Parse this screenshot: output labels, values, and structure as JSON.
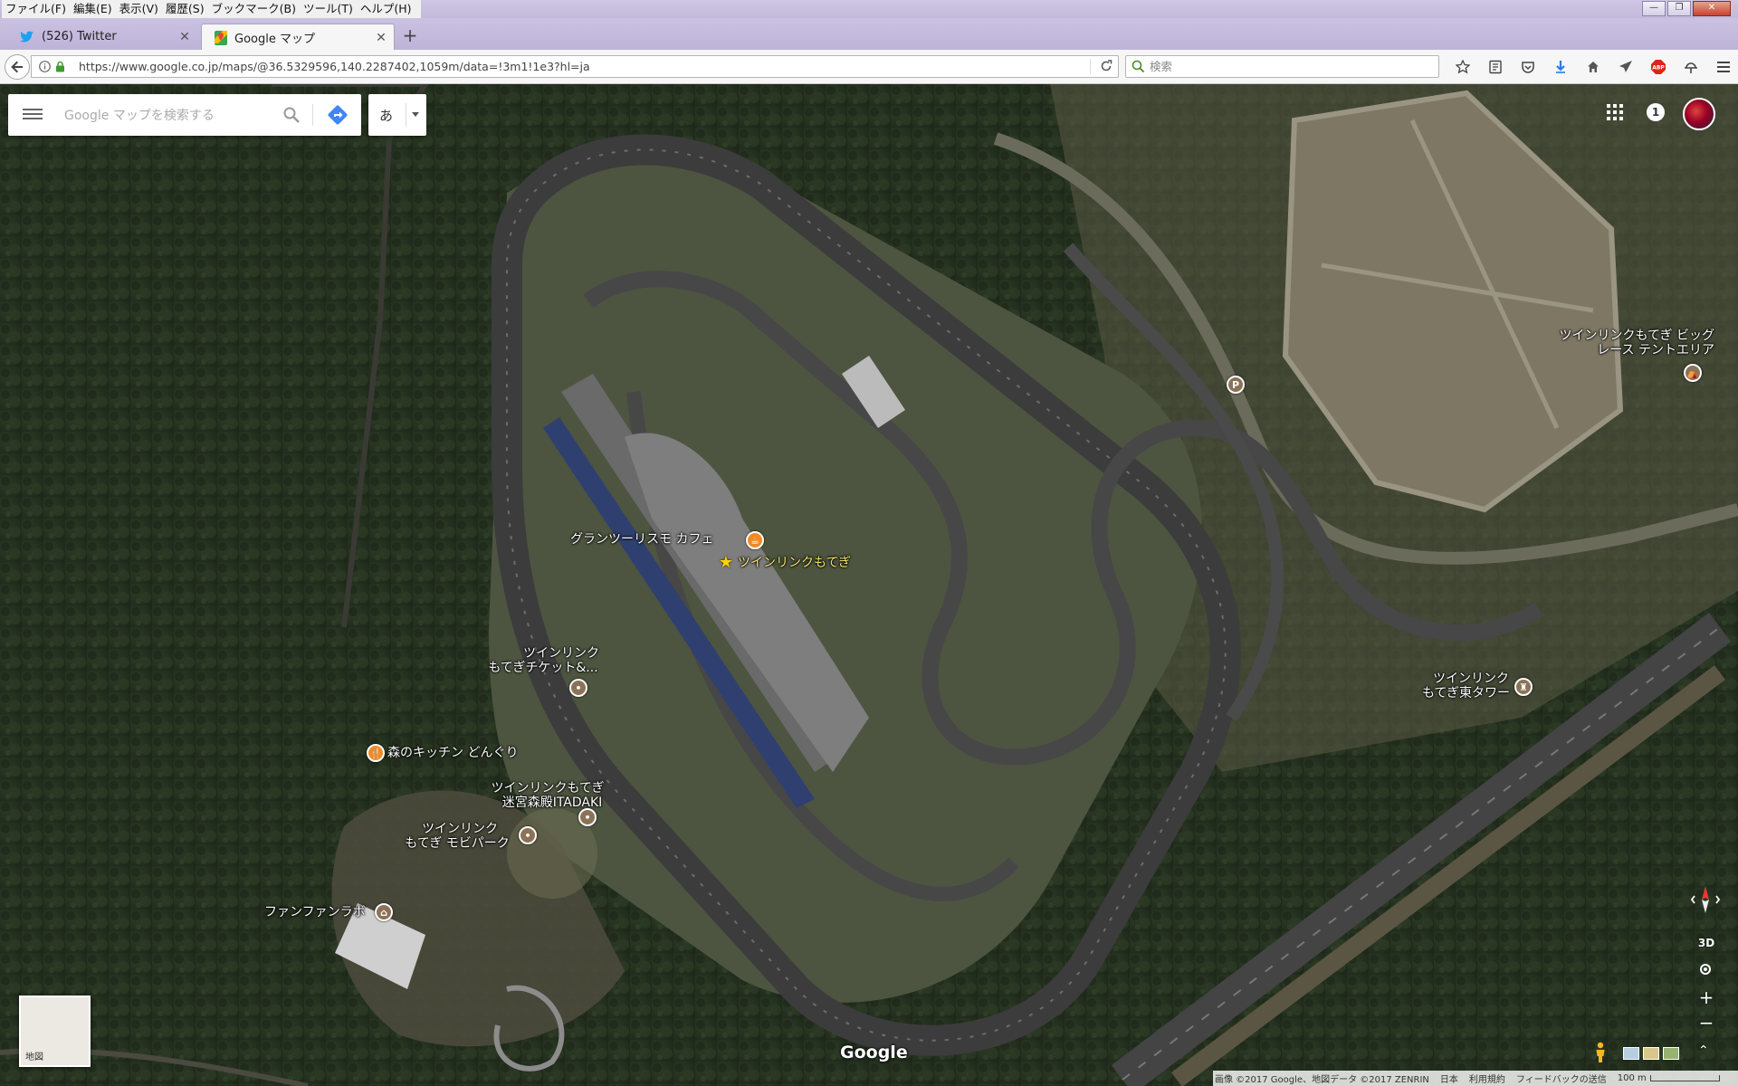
{
  "browser": {
    "menus": [
      "ファイル(F)",
      "編集(E)",
      "表示(V)",
      "履歴(S)",
      "ブックマーク(B)",
      "ツール(T)",
      "ヘルプ(H)"
    ],
    "tabs": [
      {
        "title": "(526) Twitter",
        "active": false,
        "icon": "twitter-bird-icon"
      },
      {
        "title": "Google マップ",
        "active": true,
        "icon": "google-maps-icon"
      }
    ],
    "url": "https://www.google.co.jp/maps/@36.5329596,140.2287402,1059m/data=!3m1!1e3?hl=ja",
    "search_placeholder": "検索",
    "toolbar_icons": [
      "bookmark-star-icon",
      "reading-list-icon",
      "pocket-icon",
      "download-icon",
      "home-icon",
      "send-icon",
      "adblock-icon",
      "extension-icon",
      "menu-icon"
    ]
  },
  "maps": {
    "search_placeholder": "Google マップを検索する",
    "ime_mode": "あ",
    "notification_count": "1",
    "places": {
      "cafe": "グランツーリスモ カフェ",
      "main": "ツインリンクもてぎ",
      "ticket_1": "ツインリンク",
      "ticket_2": "もてぎチケット&...",
      "kitchen": "森のキッチン どんぐり",
      "tadaki_1": "ツインリンクもてぎ",
      "tadaki_2": "迷宮森殿ITADAKI",
      "mobipark_1": "ツインリンク",
      "mobipark_2": "もてぎ モビパーク",
      "funfan": "ファンファンラボ",
      "bigrace_1": "ツインリンクもてぎ ビッグ",
      "bigrace_2": "レース テントエリア",
      "easttower_1": "ツインリンク",
      "easttower_2": "もてぎ東タワー"
    },
    "parking_letter": "P",
    "map_type_label": "地図",
    "btn_3d": "3D",
    "zoom_in": "+",
    "zoom_out": "−",
    "collapse": "⌃",
    "logo": "Google",
    "footer": {
      "imagery": "画像 ©2017 Google、地図データ ©2017 ZENRIN",
      "country": "日本",
      "terms": "利用規約",
      "feedback": "フィードバックの送信",
      "scale": "100 m"
    }
  }
}
